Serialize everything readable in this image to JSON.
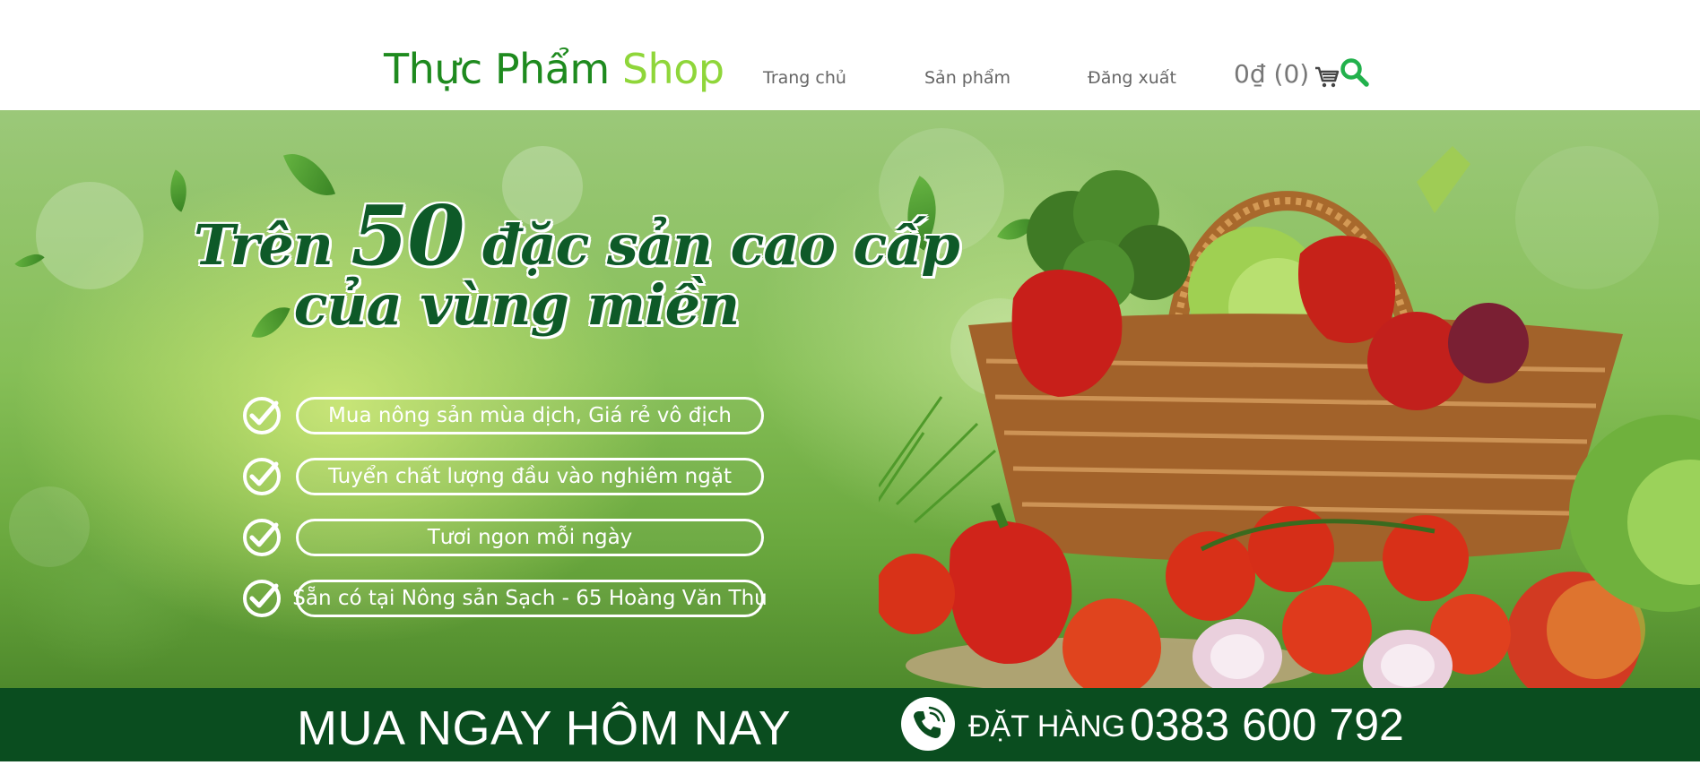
{
  "header": {
    "logo_part1": "Thực Phẩm",
    "logo_part2": "Shop",
    "nav": [
      {
        "label": "Trang chủ"
      },
      {
        "label": "Sản phẩm"
      },
      {
        "label": "Đăng xuất"
      }
    ],
    "cart_text": "0₫ (0)",
    "cart_icon": "cart-icon",
    "search_icon": "search-icon"
  },
  "banner": {
    "headline_word1": "Trên",
    "headline_number": "50",
    "headline_rest": "đặc sản cao cấp",
    "headline_line2": "của vùng miền",
    "features": [
      {
        "text": "Mua nông sản mùa dịch, Giá rẻ vô địch"
      },
      {
        "text": "Tuyển chất lượng đầu vào nghiêm ngặt"
      },
      {
        "text": "Tươi ngon mỗi ngày"
      },
      {
        "text": "Sẵn có tại Nông sản Sạch - 65 Hoàng Văn Thụ"
      }
    ]
  },
  "cta": {
    "left_text": "MUA NGAY HÔM NAY",
    "order_label": "ĐẶT HÀNG",
    "phone": "0383 600 792"
  },
  "colors": {
    "logo_dark_green": "#1e8a1e",
    "logo_light_green": "#8fd63a",
    "search_green": "#22b14c",
    "cta_bar": "#0a4d1f",
    "headline": "#0e5a28"
  }
}
